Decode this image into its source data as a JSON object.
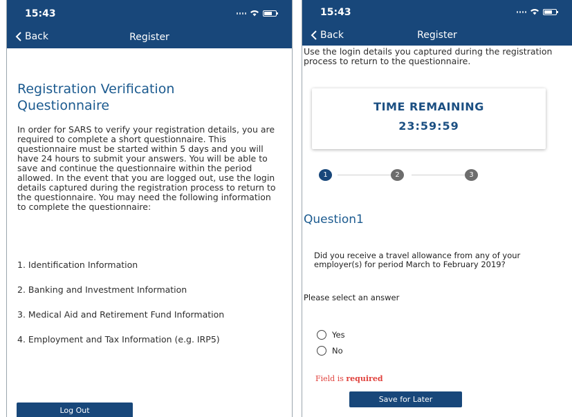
{
  "status": {
    "time": "15:43"
  },
  "nav": {
    "back_label": "Back",
    "title": "Register"
  },
  "left": {
    "heading": "Registration Verification Questionnaire",
    "intro": "In order for SARS to verify your registration details, you are required to complete a short questionnaire. This questionnaire must be started within 5 days and you will have 24 hours to submit your answers. You will be able to save and continue the questionnaire within the period allowed. In the event that you are logged out, use the login details captured during the registration process to return to the questionnaire. You may need the following information to complete the questionnaire:",
    "items": [
      "1. Identification Information",
      "2. Banking and Investment Information",
      "3. Medical Aid and Retirement Fund Information",
      "4. Employment and Tax Information (e.g. IRP5)"
    ],
    "logout_label": "Log Out"
  },
  "right": {
    "top_text": "Use the login details you captured during the registration process to return to the questionnaire.",
    "timer_label": "TIME REMAINING",
    "timer_value": "23:59:59",
    "steps": [
      "1",
      "2",
      "3"
    ],
    "question_title": "Question1",
    "question_text": "Did you receive a travel allowance from any of your employer(s) for period March to February 2019?",
    "prompt": "Please select an answer",
    "options": [
      "Yes",
      "No"
    ],
    "error_prefix": "Field is ",
    "error_bold": "required",
    "save_label": "Save for Later"
  },
  "colors": {
    "brand": "#18477a",
    "heading": "#1b5a8f",
    "error": "#e0413c"
  }
}
